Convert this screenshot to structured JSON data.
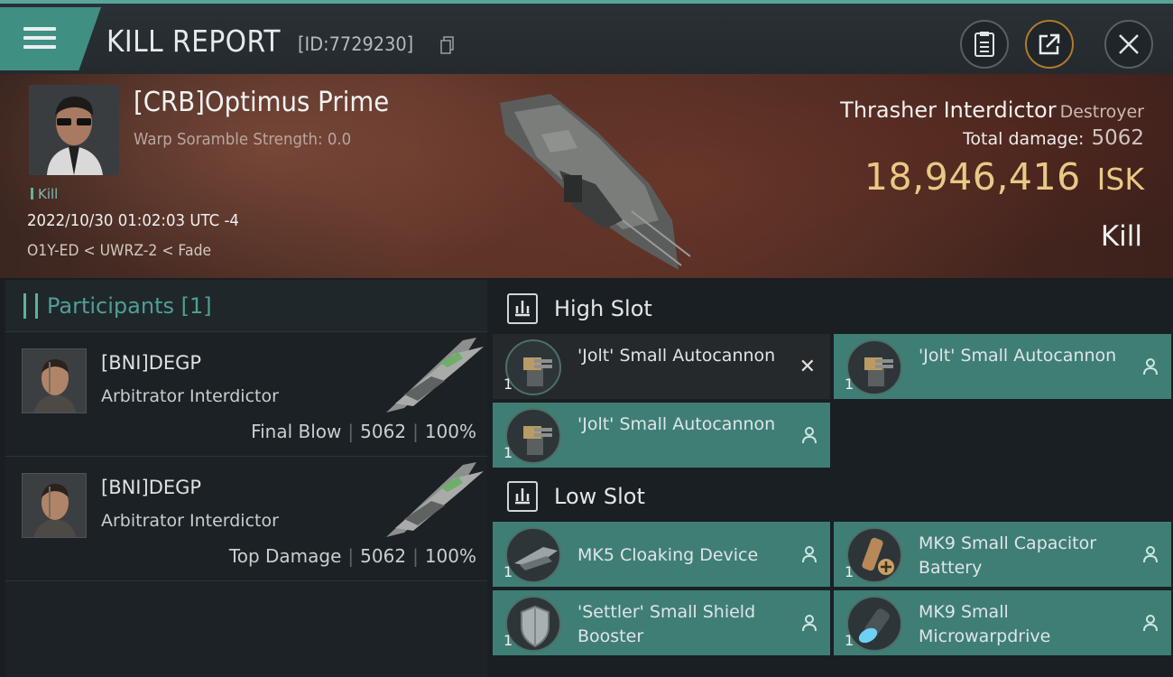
{
  "header": {
    "title": "KILL REPORT",
    "report_id": "[ID:7729230]",
    "icons": [
      "menu-icon",
      "copy-icon",
      "clipboard-icon",
      "share-icon",
      "close-icon"
    ]
  },
  "victim": {
    "name": "[CRB]Optimus Prime",
    "warp_scramble": "Warp Soramble Strength: 0.0",
    "kill_tag": "Kill",
    "datetime": "2022/10/30 01:02:03 UTC -4",
    "location": "O1Y-ED < UWRZ-2 < Fade",
    "ship_name": "Thrasher Interdictor",
    "ship_class": "Destroyer",
    "total_damage_label": "Total damage:",
    "total_damage": "5062",
    "isk_value": "18,946,416",
    "isk_unit": "ISK",
    "result": "Kill"
  },
  "participants": {
    "title": "Participants",
    "count": "[1]",
    "rows": [
      {
        "name": "[BNI]DEGP",
        "ship": "Arbitrator Interdictor",
        "label": "Final Blow",
        "damage": "5062",
        "percent": "100%",
        "sep": "|"
      },
      {
        "name": "[BNI]DEGP",
        "ship": "Arbitrator Interdictor",
        "label": "Top Damage",
        "damage": "5062",
        "percent": "100%",
        "sep": "|"
      }
    ]
  },
  "slots": {
    "high": {
      "label": "High Slot",
      "modules": [
        {
          "name": "'Jolt' Small Autocannon",
          "qty": "1",
          "state": "destroyed"
        },
        {
          "name": "'Jolt' Small Autocannon",
          "qty": "1",
          "state": "dropped"
        },
        {
          "name": "'Jolt' Small Autocannon",
          "qty": "1",
          "state": "dropped"
        }
      ]
    },
    "low": {
      "label": "Low Slot",
      "modules": [
        {
          "name": "MK5 Cloaking Device",
          "qty": "1",
          "state": "dropped"
        },
        {
          "name": "MK9 Small Capacitor Battery",
          "qty": "1",
          "state": "dropped"
        },
        {
          "name": "'Settler' Small Shield Booster",
          "qty": "1",
          "state": "dropped"
        },
        {
          "name": "MK9 Small Microwarpdrive",
          "qty": "1",
          "state": "dropped"
        }
      ]
    }
  },
  "colors": {
    "accent": "#3f8f83",
    "isk": "#e9c985",
    "module_bg": "#3f7e75"
  }
}
